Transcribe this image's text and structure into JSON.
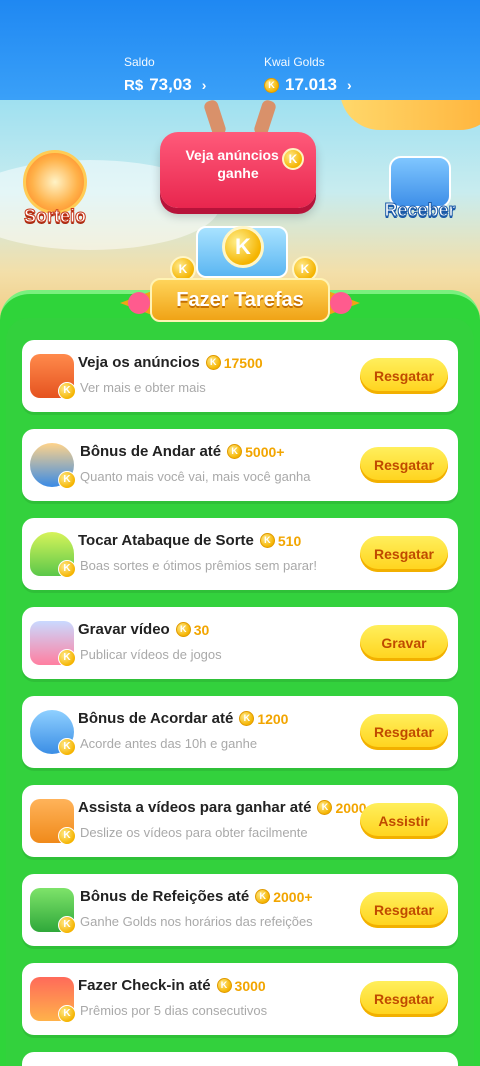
{
  "balances": {
    "saldo": {
      "label": "Saldo",
      "currency": "R$",
      "value": "73,03"
    },
    "golds": {
      "label": "Kwai Golds",
      "value": "17.013"
    }
  },
  "banner": {
    "main_button": "Veja anúncios e ganhe",
    "left_label": "Sorteio",
    "right_label": "Receber",
    "section_title": "Fazer Tarefas"
  },
  "tasks": [
    {
      "title": "Veja os anúncios",
      "reward": "17500",
      "subtitle": "Ver mais e obter mais",
      "button": "Resgatar",
      "icon": "tv-icon"
    },
    {
      "title": "Bônus de Andar até",
      "reward": "5000+",
      "subtitle": "Quanto mais você vai, mais você ganha",
      "button": "Resgatar",
      "icon": "walking-boy-icon"
    },
    {
      "title": "Tocar Atabaque de Sorte",
      "reward": "510",
      "subtitle": "Boas sortes e ótimos prêmios sem parar!",
      "button": "Resgatar",
      "icon": "drum-icon"
    },
    {
      "title": "Gravar vídeo",
      "reward": "30",
      "subtitle": "Publicar vídeos de jogos",
      "button": "Gravar",
      "icon": "video-camera-icon"
    },
    {
      "title": "Bônus de Acordar até",
      "reward": "1200",
      "subtitle": "Acorde antes das 10h e ganhe",
      "button": "Resgatar",
      "icon": "moon-icon"
    },
    {
      "title": "Assista a vídeos para ganhar até",
      "reward": "2000",
      "subtitle": "Deslize os vídeos para obter facilmente",
      "button": "Assistir",
      "icon": "movie-camera-icon"
    },
    {
      "title": "Bônus de Refeições até",
      "reward": "2000+",
      "subtitle": "Ganhe Golds nos horários das refeições",
      "button": "Resgatar",
      "icon": "meal-icon"
    },
    {
      "title": "Fazer Check-in até",
      "reward": "3000",
      "subtitle": "Prêmios por 5 dias consecutivos",
      "button": "Resgatar",
      "icon": "calendar-icon"
    }
  ],
  "colors": {
    "topbar": "#1f88f2",
    "green": "#2fd43a",
    "button": "#ffd21a",
    "button_text": "#c04a00",
    "coin": "#f5b400"
  },
  "coin_letter": "K"
}
